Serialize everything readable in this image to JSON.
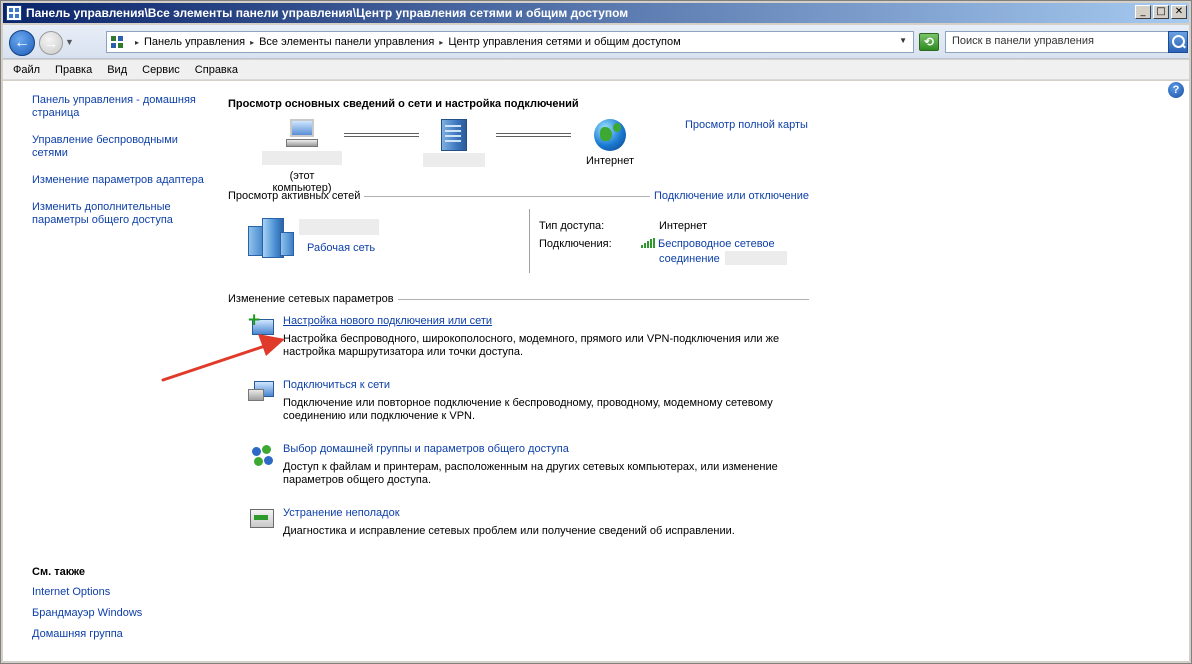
{
  "window": {
    "title": "Панель управления\\Все элементы панели управления\\Центр управления сетями и общим доступом"
  },
  "address": {
    "crumbs": [
      "Панель управления",
      "Все элементы панели управления",
      "Центр управления сетями и общим доступом"
    ],
    "search_placeholder": "Поиск в панели управления"
  },
  "menu": [
    "Файл",
    "Правка",
    "Вид",
    "Сервис",
    "Справка"
  ],
  "sidebar": {
    "items": [
      {
        "label": "Панель управления - домашняя страница"
      },
      {
        "label": "Управление беспроводными сетями"
      },
      {
        "label": "Изменение параметров адаптера"
      },
      {
        "label": "Изменить дополнительные параметры общего доступа"
      }
    ]
  },
  "see_also": {
    "title": "См. также",
    "items": [
      "Internet Options",
      "Брандмауэр Windows",
      "Домашняя группа"
    ]
  },
  "main": {
    "title": "Просмотр основных сведений о сети и настройка подключений",
    "full_map_link": "Просмотр полной карты",
    "map": {
      "computer_label": "(этот компьютер)",
      "internet_label": "Интернет"
    },
    "active_networks": {
      "header": "Просмотр активных сетей",
      "connect_link": "Подключение или отключение",
      "network_type_link": "Рабочая сеть",
      "access_type_label": "Тип доступа:",
      "access_type_value": "Интернет",
      "connections_label": "Подключения:",
      "connection_link_line1": "Беспроводное сетевое",
      "connection_link_line2": "соединение"
    },
    "change_settings": {
      "header": "Изменение сетевых параметров",
      "tasks": [
        {
          "icon": "new-connection-icon",
          "link": "Настройка нового подключения или сети",
          "desc": "Настройка беспроводного, широкополосного, модемного, прямого или VPN-подключения или же настройка маршрутизатора или точки доступа."
        },
        {
          "icon": "connect-network-icon",
          "link": "Подключиться к сети",
          "desc": "Подключение или повторное подключение к беспроводному, проводному, модемному сетевому соединению или подключение к VPN."
        },
        {
          "icon": "homegroup-icon",
          "link": "Выбор домашней группы и параметров общего доступа",
          "desc": "Доступ к файлам и принтерам, расположенным на других сетевых компьютерах, или изменение параметров общего доступа."
        },
        {
          "icon": "troubleshoot-icon",
          "link": "Устранение неполадок",
          "desc": "Диагностика и исправление сетевых проблем или получение сведений об исправлении."
        }
      ]
    }
  },
  "colors": {
    "link": "#0d3fa8",
    "title_bar_start": "#0a246a",
    "title_bar_end": "#a6caf0",
    "annotation_arrow": "#e03a2a"
  }
}
